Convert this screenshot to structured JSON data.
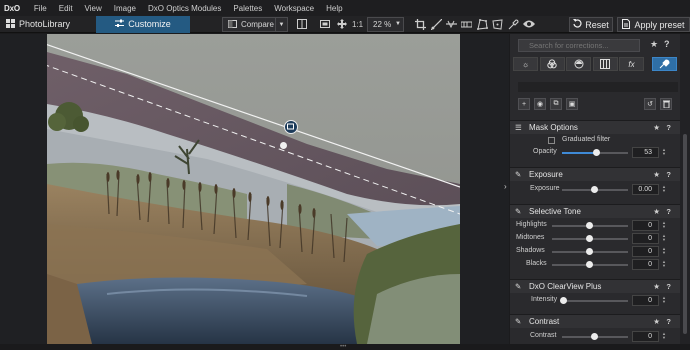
{
  "menubar": {
    "logo": "DxO",
    "items": [
      "File",
      "Edit",
      "View",
      "Image",
      "DxO Optics Modules",
      "Palettes",
      "Workspace",
      "Help"
    ]
  },
  "toolbar": {
    "photolibrary_label": "PhotoLibrary",
    "customize_label": "Customize",
    "compare_label": "Compare",
    "ratio_label": "1:1",
    "zoom_value": "22 %",
    "reset_label": "Reset",
    "apply_preset_label": "Apply preset",
    "accent_color": "#245a82"
  },
  "panel": {
    "search_placeholder": "Search for corrections...",
    "categories": [
      "light-icon",
      "color-icon",
      "detail-icon",
      "geometry-icon",
      "effects-icon",
      "local-adjustments-icon"
    ],
    "category_effects_label": "fx",
    "sections": {
      "mask_options": {
        "title": "Mask Options",
        "mask_type": "Graduated filter",
        "opacity_label": "Opacity",
        "opacity_value": "53"
      },
      "exposure": {
        "title": "Exposure",
        "exposure_label": "Exposure",
        "exposure_value": "0.00"
      },
      "selective_tone": {
        "title": "Selective Tone",
        "rows": [
          {
            "label": "Highlights",
            "value": "0"
          },
          {
            "label": "Midtones",
            "value": "0"
          },
          {
            "label": "Shadows",
            "value": "0"
          },
          {
            "label": "Blacks",
            "value": "0"
          }
        ]
      },
      "clearview": {
        "title": "DxO ClearView Plus",
        "intensity_label": "Intensity",
        "intensity_value": "0"
      },
      "contrast": {
        "title": "Contrast",
        "contrast_label": "Contrast",
        "contrast_value": "0"
      }
    }
  },
  "icons": {
    "star": "★",
    "help": "?"
  }
}
